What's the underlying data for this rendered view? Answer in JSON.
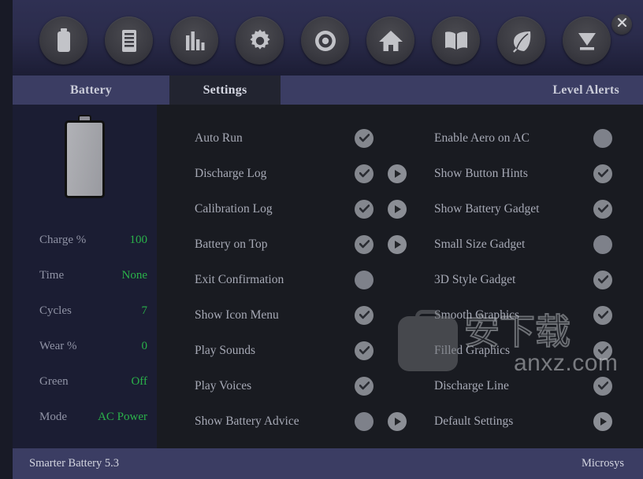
{
  "window": {
    "close_label": "×"
  },
  "toolbar": {
    "buttons": [
      {
        "name": "battery-icon",
        "label": "Battery"
      },
      {
        "name": "log-icon",
        "label": "Log"
      },
      {
        "name": "bar-chart-icon",
        "label": "Statistics"
      },
      {
        "name": "gear-icon",
        "label": "Settings"
      },
      {
        "name": "target-icon",
        "label": "Calibration"
      },
      {
        "name": "home-icon",
        "label": "Home"
      },
      {
        "name": "book-icon",
        "label": "Manual"
      },
      {
        "name": "leaf-icon",
        "label": "Green Mode"
      },
      {
        "name": "funnel-icon",
        "label": "Drain"
      }
    ]
  },
  "tabs": [
    {
      "label": "Battery",
      "active": false
    },
    {
      "label": "Settings",
      "active": true
    },
    {
      "label": "Level Alerts",
      "active": false
    }
  ],
  "battery_panel": {
    "charge_fill_percent": 100,
    "stats": [
      {
        "label": "Charge %",
        "value": "100"
      },
      {
        "label": "Time",
        "value": "None"
      },
      {
        "label": "Cycles",
        "value": "7"
      },
      {
        "label": "Wear %",
        "value": "0"
      },
      {
        "label": "Green",
        "value": "Off"
      },
      {
        "label": "Mode",
        "value": "AC Power"
      }
    ],
    "value_color": "#2ab24a",
    "label_color": "#9093a5"
  },
  "settings": {
    "left_column": [
      {
        "label": "Auto Run",
        "checked": true,
        "has_action": false
      },
      {
        "label": "Discharge Log",
        "checked": true,
        "has_action": true
      },
      {
        "label": "Calibration Log",
        "checked": true,
        "has_action": true
      },
      {
        "label": "Battery on Top",
        "checked": true,
        "has_action": true
      },
      {
        "label": "Exit Confirmation",
        "checked": false,
        "has_action": false
      },
      {
        "label": "Show Icon Menu",
        "checked": true,
        "has_action": false
      },
      {
        "label": "Play Sounds",
        "checked": true,
        "has_action": false
      },
      {
        "label": "Play Voices",
        "checked": true,
        "has_action": false
      },
      {
        "label": "Show Battery Advice",
        "checked": false,
        "has_action": true
      }
    ],
    "right_column": [
      {
        "label": "Enable Aero on AC",
        "checked": false,
        "has_action": false
      },
      {
        "label": "Show Button Hints",
        "checked": true,
        "has_action": false
      },
      {
        "label": "Show Battery Gadget",
        "checked": true,
        "has_action": false
      },
      {
        "label": "Small Size Gadget",
        "checked": false,
        "has_action": false
      },
      {
        "label": "3D Style Gadget",
        "checked": true,
        "has_action": false
      },
      {
        "label": "Smooth Graphics",
        "checked": true,
        "has_action": false
      },
      {
        "label": "Filled Graphics",
        "checked": true,
        "has_action": false
      },
      {
        "label": "Discharge Line",
        "checked": true,
        "has_action": false
      },
      {
        "label": "Default Settings",
        "checked": null,
        "has_action": true,
        "action_only": true
      }
    ]
  },
  "statusbar": {
    "app_name": "Smarter Battery 5.3",
    "vendor": "Microsys"
  },
  "watermark": {
    "text": "anxz.com",
    "cjk": "安下载"
  },
  "colors": {
    "toolbar_top": "#2f3053",
    "toolbar_bottom": "#1c1d35",
    "tabbar": "#3b3d63",
    "active_tab": "#222430",
    "left_panel": "#1b1d33",
    "content": "#191b21",
    "statusbar": "#3b3d63",
    "accent_green": "#2ab24a",
    "toggle": "#84878e"
  }
}
